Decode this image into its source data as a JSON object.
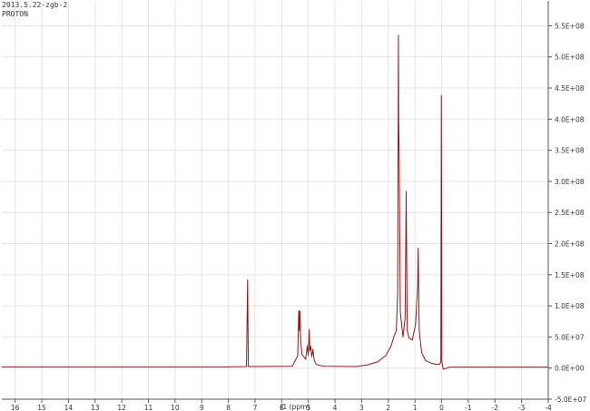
{
  "header": {
    "sample_id": "2013.5.22-zgb-2",
    "experiment": "PROTON"
  },
  "chart_data": {
    "type": "line",
    "title": "",
    "xlabel": "f1 (ppm)",
    "ylabel": "",
    "xlim": [
      16.5,
      -4.0
    ],
    "ylim": [
      -50000000,
      590000000
    ],
    "x_ticks": [
      16,
      15,
      14,
      13,
      12,
      11,
      10,
      9,
      8,
      7,
      6,
      5,
      4,
      3,
      2,
      1,
      0,
      -1,
      -2,
      -3,
      -4
    ],
    "y_ticks": [
      -50000000,
      0,
      50000000,
      100000000,
      150000000,
      200000000,
      250000000,
      300000000,
      350000000,
      400000000,
      450000000,
      500000000,
      550000000
    ],
    "y_tick_labels": [
      "-5.0E+07",
      "0.0E+00",
      "5.0E+07",
      "1.0E+08",
      "1.5E+08",
      "2.0E+08",
      "2.5E+08",
      "3.0E+08",
      "3.5E+08",
      "4.0E+08",
      "4.5E+08",
      "5.0E+08",
      "5.5E+08"
    ],
    "grid": true,
    "colors": {
      "line": "#8b1a1a",
      "grid": "#e4e4e4",
      "axis": "#555555"
    },
    "series": [
      {
        "points": [
          [
            16.5,
            2000000
          ],
          [
            8.0,
            2000000
          ],
          [
            7.32,
            2500000
          ],
          [
            7.28,
            142000000
          ],
          [
            7.25,
            2500000
          ],
          [
            5.6,
            3000000
          ],
          [
            5.4,
            20000000
          ],
          [
            5.36,
            92000000
          ],
          [
            5.34,
            60000000
          ],
          [
            5.32,
            92000000
          ],
          [
            5.28,
            40000000
          ],
          [
            5.24,
            22000000
          ],
          [
            5.1,
            14000000
          ],
          [
            5.04,
            36000000
          ],
          [
            5.0,
            20000000
          ],
          [
            4.97,
            62000000
          ],
          [
            4.94,
            28000000
          ],
          [
            4.91,
            35000000
          ],
          [
            4.87,
            18000000
          ],
          [
            4.83,
            30000000
          ],
          [
            4.78,
            12000000
          ],
          [
            4.7,
            6000000
          ],
          [
            4.55,
            4000000
          ],
          [
            4.4,
            3000000
          ],
          [
            3.2,
            2500000
          ],
          [
            2.8,
            5000000
          ],
          [
            2.4,
            10000000
          ],
          [
            2.1,
            20000000
          ],
          [
            1.9,
            35000000
          ],
          [
            1.78,
            52000000
          ],
          [
            1.7,
            60000000
          ],
          [
            1.65,
            120000000
          ],
          [
            1.62,
            535000000
          ],
          [
            1.61,
            395000000
          ],
          [
            1.59,
            330000000
          ],
          [
            1.55,
            90000000
          ],
          [
            1.45,
            50000000
          ],
          [
            1.37,
            80000000
          ],
          [
            1.33,
            284000000
          ],
          [
            1.29,
            60000000
          ],
          [
            1.22,
            48000000
          ],
          [
            1.1,
            45000000
          ],
          [
            0.98,
            70000000
          ],
          [
            0.9,
            130000000
          ],
          [
            0.88,
            193000000
          ],
          [
            0.84,
            60000000
          ],
          [
            0.75,
            25000000
          ],
          [
            0.6,
            12000000
          ],
          [
            0.4,
            8000000
          ],
          [
            0.2,
            6000000
          ],
          [
            0.08,
            6000000
          ],
          [
            0.03,
            10000000
          ],
          [
            0.01,
            438000000
          ],
          [
            -0.01,
            10000000
          ],
          [
            -0.06,
            -2000000
          ],
          [
            -0.3,
            1500000
          ],
          [
            -4.0,
            1500000
          ]
        ]
      }
    ]
  }
}
